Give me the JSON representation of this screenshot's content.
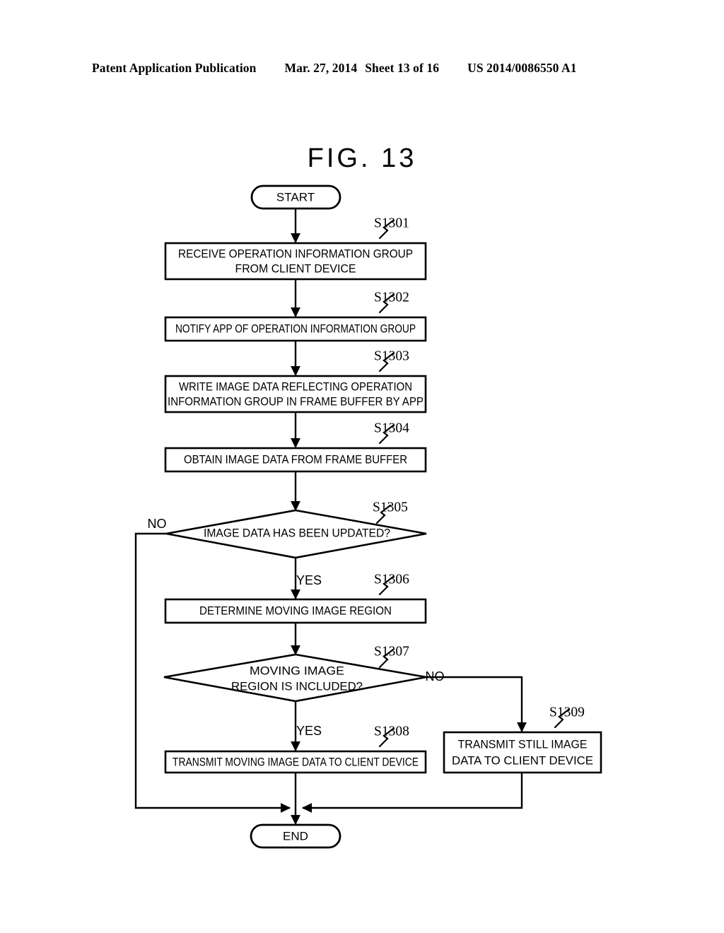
{
  "header": {
    "publication": "Patent Application Publication",
    "date": "Mar. 27, 2014",
    "sheet": "Sheet 13 of 16",
    "patent_number": "US 2014/0086550 A1"
  },
  "figure": {
    "title": "FIG. 13"
  },
  "flowchart": {
    "start_label": "START",
    "end_label": "END",
    "nodes": {
      "s1301": {
        "step": "S1301",
        "lines": [
          "RECEIVE OPERATION INFORMATION GROUP",
          "FROM CLIENT DEVICE"
        ]
      },
      "s1302": {
        "step": "S1302",
        "lines": [
          "NOTIFY APP OF OPERATION INFORMATION GROUP"
        ]
      },
      "s1303": {
        "step": "S1303",
        "lines": [
          "WRITE IMAGE DATA REFLECTING OPERATION",
          "INFORMATION GROUP IN FRAME BUFFER BY APP"
        ]
      },
      "s1304": {
        "step": "S1304",
        "lines": [
          "OBTAIN IMAGE DATA FROM FRAME BUFFER"
        ]
      },
      "s1305": {
        "step": "S1305",
        "lines": [
          "IMAGE DATA HAS BEEN UPDATED?"
        ],
        "branch_no": "NO",
        "branch_yes": "YES"
      },
      "s1306": {
        "step": "S1306",
        "lines": [
          "DETERMINE MOVING IMAGE REGION"
        ]
      },
      "s1307": {
        "step": "S1307",
        "lines": [
          "MOVING IMAGE",
          "REGION IS INCLUDED?"
        ],
        "branch_no": "NO",
        "branch_yes": "YES"
      },
      "s1308": {
        "step": "S1308",
        "lines": [
          "TRANSMIT MOVING IMAGE DATA TO CLIENT DEVICE"
        ]
      },
      "s1309": {
        "step": "S1309",
        "lines": [
          "TRANSMIT STILL IMAGE",
          "DATA TO CLIENT DEVICE"
        ]
      }
    }
  },
  "colors": {
    "ink": "#000000",
    "paper": "#ffffff"
  }
}
